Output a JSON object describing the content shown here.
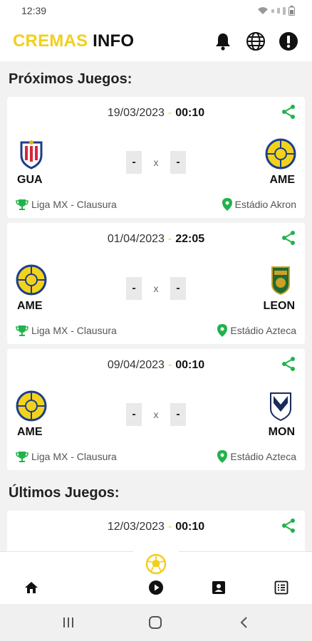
{
  "status_bar": {
    "time": "12:39"
  },
  "app": {
    "title_part1": "CREMAS",
    "title_part2": "INFO"
  },
  "sections": {
    "upcoming": "Próximos Juegos:",
    "past": "Últimos Juegos:"
  },
  "matches": [
    {
      "date": "19/03/2023",
      "separator": "-",
      "time": "00:10",
      "home": "GUA",
      "away": "AME",
      "home_score": "-",
      "vs": "x",
      "away_score": "-",
      "league": "Liga MX - Clausura",
      "venue": "Estádio Akron"
    },
    {
      "date": "01/04/2023",
      "separator": "-",
      "time": "22:05",
      "home": "AME",
      "away": "LEON",
      "home_score": "-",
      "vs": "x",
      "away_score": "-",
      "league": "Liga MX - Clausura",
      "venue": "Estádio Azteca"
    },
    {
      "date": "09/04/2023",
      "separator": "-",
      "time": "00:10",
      "home": "AME",
      "away": "MON",
      "home_score": "-",
      "vs": "x",
      "away_score": "-",
      "league": "Liga MX - Clausura",
      "venue": "Estádio Azteca"
    }
  ],
  "past_matches": [
    {
      "date": "12/03/2023",
      "separator": "-",
      "time": "00:10"
    }
  ],
  "colors": {
    "brand_yellow": "#f2cf1c",
    "accent_green": "#22b24c",
    "dark": "#111111"
  }
}
